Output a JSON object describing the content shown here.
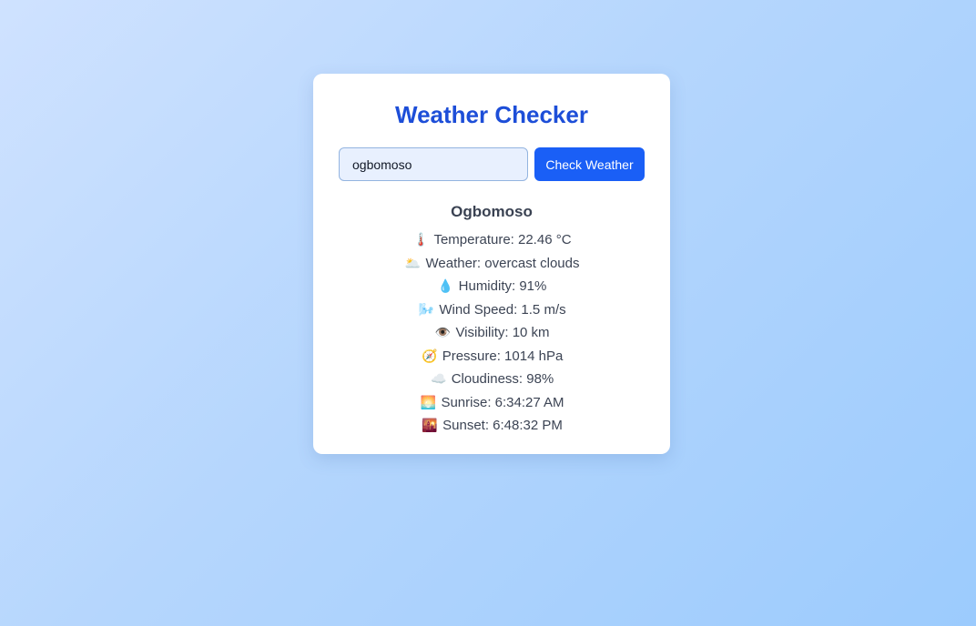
{
  "app": {
    "title": "Weather Checker"
  },
  "search": {
    "value": "ogbomoso",
    "button_label": "Check Weather"
  },
  "result": {
    "city": "Ogbomoso",
    "details": [
      {
        "icon": "thermometer-icon",
        "glyph": "🌡️",
        "text": "Temperature: 22.46 °C"
      },
      {
        "icon": "cloud-sun-icon",
        "glyph": "🌥️",
        "text": "Weather: overcast clouds"
      },
      {
        "icon": "droplet-icon",
        "glyph": "💧",
        "text": "Humidity: 91%"
      },
      {
        "icon": "wind-icon",
        "glyph": "🌬️",
        "text": "Wind Speed: 1.5 m/s"
      },
      {
        "icon": "eye-icon",
        "glyph": "👁️",
        "text": "Visibility: 10 km"
      },
      {
        "icon": "compass-icon",
        "glyph": "🧭",
        "text": "Pressure: 1014 hPa"
      },
      {
        "icon": "cloud-icon",
        "glyph": "☁️",
        "text": "Cloudiness: 98%"
      },
      {
        "icon": "sunrise-icon",
        "glyph": "🌅",
        "text": "Sunrise: 6:34:27 AM"
      },
      {
        "icon": "sunset-icon",
        "glyph": "🌇",
        "text": "Sunset: 6:48:32 PM"
      }
    ]
  },
  "colors": {
    "title": "#1d4ed8",
    "button": "#1a5ff6",
    "input_bg": "#e8f0fe"
  }
}
